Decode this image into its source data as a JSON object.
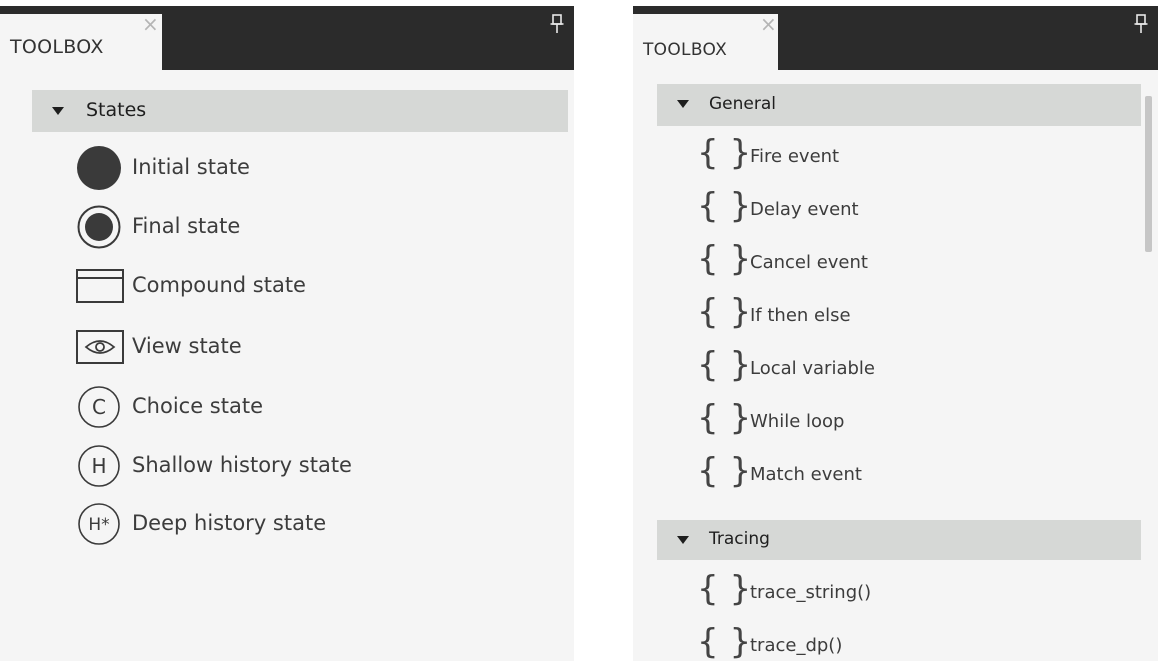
{
  "left_panel": {
    "tab_title": "TOOLBOX",
    "category": {
      "label": "States",
      "expanded": true
    },
    "items": [
      {
        "label": "Initial state",
        "icon": "filled-circle-icon"
      },
      {
        "label": "Final state",
        "icon": "ringed-circle-icon"
      },
      {
        "label": "Compound state",
        "icon": "rectangle-icon"
      },
      {
        "label": "View state",
        "icon": "eye-icon"
      },
      {
        "label": "Choice state",
        "icon": "circle-c-icon"
      },
      {
        "label": "Shallow history state",
        "icon": "circle-h-icon"
      },
      {
        "label": "Deep history state",
        "icon": "circle-h-star-icon"
      }
    ],
    "icon_letters": {
      "choice": "C",
      "shallow": "H",
      "deep": "H*"
    }
  },
  "right_panel": {
    "tab_title": "TOOLBOX",
    "categories": [
      {
        "label": "General",
        "expanded": true,
        "items": [
          {
            "label": "Fire event"
          },
          {
            "label": "Delay event"
          },
          {
            "label": "Cancel event"
          },
          {
            "label": "If then else"
          },
          {
            "label": "Local variable"
          },
          {
            "label": "While loop"
          },
          {
            "label": "Match event"
          }
        ]
      },
      {
        "label": "Tracing",
        "expanded": true,
        "items": [
          {
            "label": "trace_string()"
          },
          {
            "label": "trace_dp()"
          }
        ]
      }
    ],
    "item_icon_glyph": "{ }"
  },
  "colors": {
    "titlebar": "#2b2b2b",
    "panel_bg": "#f5f5f5",
    "category_bg": "#d6d8d6",
    "icon_dark": "#3a3a3a"
  }
}
